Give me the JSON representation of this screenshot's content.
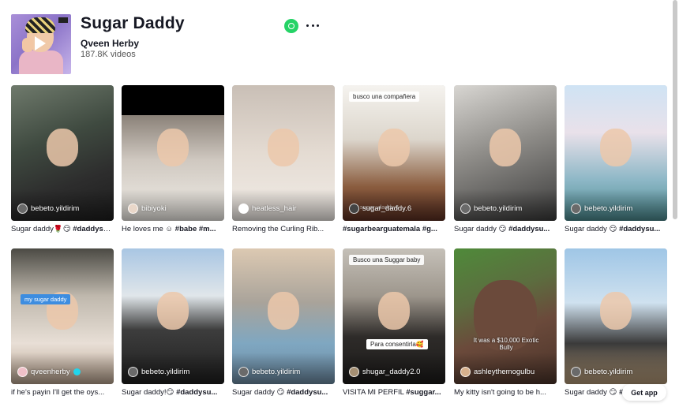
{
  "header": {
    "title": "Sugar Daddy",
    "artist": "Qveen Herby",
    "video_count": "187.8K videos",
    "share_icon": "whatsapp-icon",
    "more_icon": "more-icon"
  },
  "videos": [
    {
      "user": "bebeto.yildirim",
      "caption_text": "Sugar daddy🌹😏 ",
      "caption_tags": "#daddysu..."
    },
    {
      "user": "bibiyoki",
      "caption_text": "He loves me ☺ ",
      "caption_tags": "#babe #m..."
    },
    {
      "user": "heatless_hair",
      "caption_text": "Removing the Curling Rib...",
      "caption_tags": ""
    },
    {
      "user": "sugar_daddy.6",
      "caption_text": "",
      "caption_tags": "#sugarbearguatemala #g...",
      "overlay_top": "busco una compañera",
      "overlay_bottom": "sugar_daddy.6"
    },
    {
      "user": "bebeto.yildirim",
      "caption_text": "Sugar daddy 😏 ",
      "caption_tags": "#daddysu..."
    },
    {
      "user": "bebeto.yildirim",
      "caption_text": "Sugar daddy 😏 ",
      "caption_tags": "#daddysu..."
    },
    {
      "user": "qveenherby",
      "caption_text": "if he's payin I'll get the oys...",
      "caption_tags": "",
      "verified": true,
      "overlay_label": "my sugar daddy"
    },
    {
      "user": "bebeto.yildirim",
      "caption_text": "Sugar daddy!😏 ",
      "caption_tags": "#daddysu..."
    },
    {
      "user": "bebeto.yildirim",
      "caption_text": "Sugar daddy 😏 ",
      "caption_tags": "#daddysu..."
    },
    {
      "user": "shugar_daddy2.0",
      "caption_text": "VISITA MI PERFIL ",
      "caption_tags": "#suggar...",
      "overlay_top": "Busco una Suggar baby",
      "overlay_mid": "Para consentirla🥰"
    },
    {
      "user": "ashleythemogulbu",
      "caption_text": "My kitty isn't going to be h...",
      "caption_tags": "",
      "overlay_center": "It was a $10,000 Exotic Bully"
    },
    {
      "user": "bebeto.yildirim",
      "caption_text": "Sugar daddy 😏 ",
      "caption_tags": "#daddysu..."
    }
  ],
  "get_app_label": "Get app",
  "colors": {
    "accent_whatsapp": "#25d366",
    "text": "#161823",
    "verified": "#20d5ec"
  }
}
